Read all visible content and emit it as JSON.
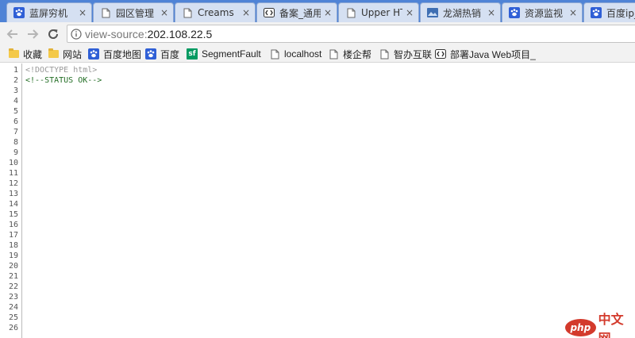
{
  "tabs": [
    {
      "title": "蓝屏穷机",
      "icon": "baidu-paw-icon",
      "close": "×"
    },
    {
      "title": "园区管理",
      "icon": "page-icon",
      "close": "×"
    },
    {
      "title": "Creams",
      "icon": "page-icon",
      "close": "×"
    },
    {
      "title": "备案_通用",
      "icon": "code-bracket-icon",
      "close": "×"
    },
    {
      "title": "Upper HT",
      "icon": "page-icon",
      "close": "×"
    },
    {
      "title": "龙湖热销",
      "icon": "picture-icon",
      "close": "×"
    },
    {
      "title": "资源监视",
      "icon": "baidu-paw-icon",
      "close": "×"
    },
    {
      "title": "百度ip_",
      "icon": "baidu-paw-icon",
      "close": ""
    }
  ],
  "toolbar": {
    "back_icon": "arrow-left-icon",
    "forward_icon": "arrow-right-icon",
    "reload_icon": "reload-icon",
    "url_prefix": "view-source:",
    "url_host": "202.108.22.5"
  },
  "bookmarks": [
    {
      "label": "收藏",
      "icon": "folder-icon"
    },
    {
      "label": "网站",
      "icon": "folder-icon"
    },
    {
      "label": "百度地图",
      "icon": "baidu-paw-icon"
    },
    {
      "label": "百度",
      "icon": "baidu-paw-icon"
    },
    {
      "label": "SegmentFault",
      "icon": "segmentfault-icon",
      "icon_text": "sf"
    },
    {
      "label": "localhost",
      "icon": "page-icon"
    },
    {
      "label": "楼企帮",
      "icon": "page-icon"
    },
    {
      "label": "智办互联",
      "icon": "page-icon"
    },
    {
      "label": "部署Java Web项目_",
      "icon": "code-bracket-icon"
    }
  ],
  "source": {
    "line_numbers": [
      "1",
      "2",
      "3",
      "4",
      "5",
      "6",
      "7",
      "8",
      "9",
      "10",
      "11",
      "12",
      "13",
      "14",
      "15",
      "16",
      "17",
      "18",
      "19",
      "20",
      "21",
      "22",
      "23",
      "24",
      "25",
      "26"
    ],
    "line1": "<!DOCTYPE html>",
    "line2": "<!--STATUS OK-->"
  },
  "watermark": {
    "badge": "php",
    "text": "中文网"
  },
  "colors": {
    "tabstrip": "#4f83d6",
    "comment": "#236e25",
    "doctype": "#999999"
  }
}
